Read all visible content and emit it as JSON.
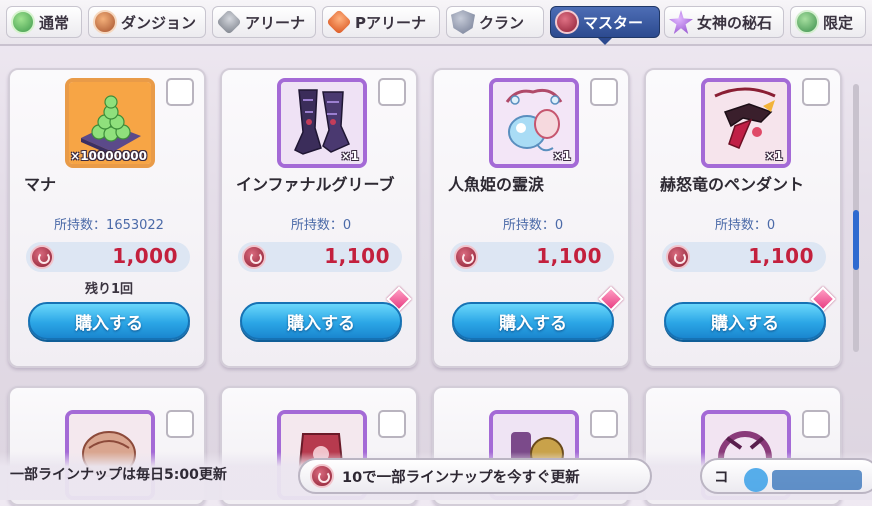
{
  "tabs": [
    {
      "label": "通常",
      "icon": "clover-icon",
      "color": "#4aa35a",
      "active": false
    },
    {
      "label": "ダンジョン",
      "icon": "dungeon-coin-icon",
      "color": "#b9673a",
      "active": false
    },
    {
      "label": "アリーナ",
      "icon": "arena-coin-icon",
      "color": "#8a8f98",
      "active": false
    },
    {
      "label": "Pアリーナ",
      "icon": "princess-arena-coin-icon",
      "color": "#e0652b",
      "active": false
    },
    {
      "label": "クラン",
      "icon": "clan-coin-icon",
      "color": "#8790a6",
      "active": false
    },
    {
      "label": "マスター",
      "icon": "master-coin-icon",
      "color": "#9a2a3f",
      "active": true
    },
    {
      "label": "女神の秘石",
      "icon": "goddess-stone-icon",
      "color": "#9a58d0",
      "active": false
    },
    {
      "label": "限定",
      "icon": "limited-coin-icon",
      "color": "#3f9a55",
      "active": false
    }
  ],
  "items": [
    {
      "name": "マナ",
      "qty": "×10000000",
      "owned": "所持数：1653022",
      "price": "1,000",
      "remain": "残り1回",
      "buy": "購入する",
      "frame": "orange",
      "icon": "mana-icon",
      "new_badge": false
    },
    {
      "name": "インファナルグリーブ",
      "qty": "×1",
      "owned": "所持数：0",
      "price": "1,100",
      "remain": "",
      "buy": "購入する",
      "frame": "purple",
      "icon": "infernal-greaves-icon",
      "new_badge": true
    },
    {
      "name": "人魚姫の霊涙",
      "qty": "×1",
      "owned": "所持数：0",
      "price": "1,100",
      "remain": "",
      "buy": "購入する",
      "frame": "purple",
      "icon": "mermaid-tear-icon",
      "new_badge": true
    },
    {
      "name": "赫怒竜のペンダント",
      "qty": "×1",
      "owned": "所持数：0",
      "price": "1,100",
      "remain": "",
      "buy": "購入する",
      "frame": "purple",
      "icon": "wrath-dragon-pendant-icon",
      "new_badge": true
    }
  ],
  "bottom": {
    "notice": "一部ラインナップは毎日5:00更新",
    "refresh_label": "10で一部ラインナップを今すぐ更新",
    "other_label": "コ"
  }
}
